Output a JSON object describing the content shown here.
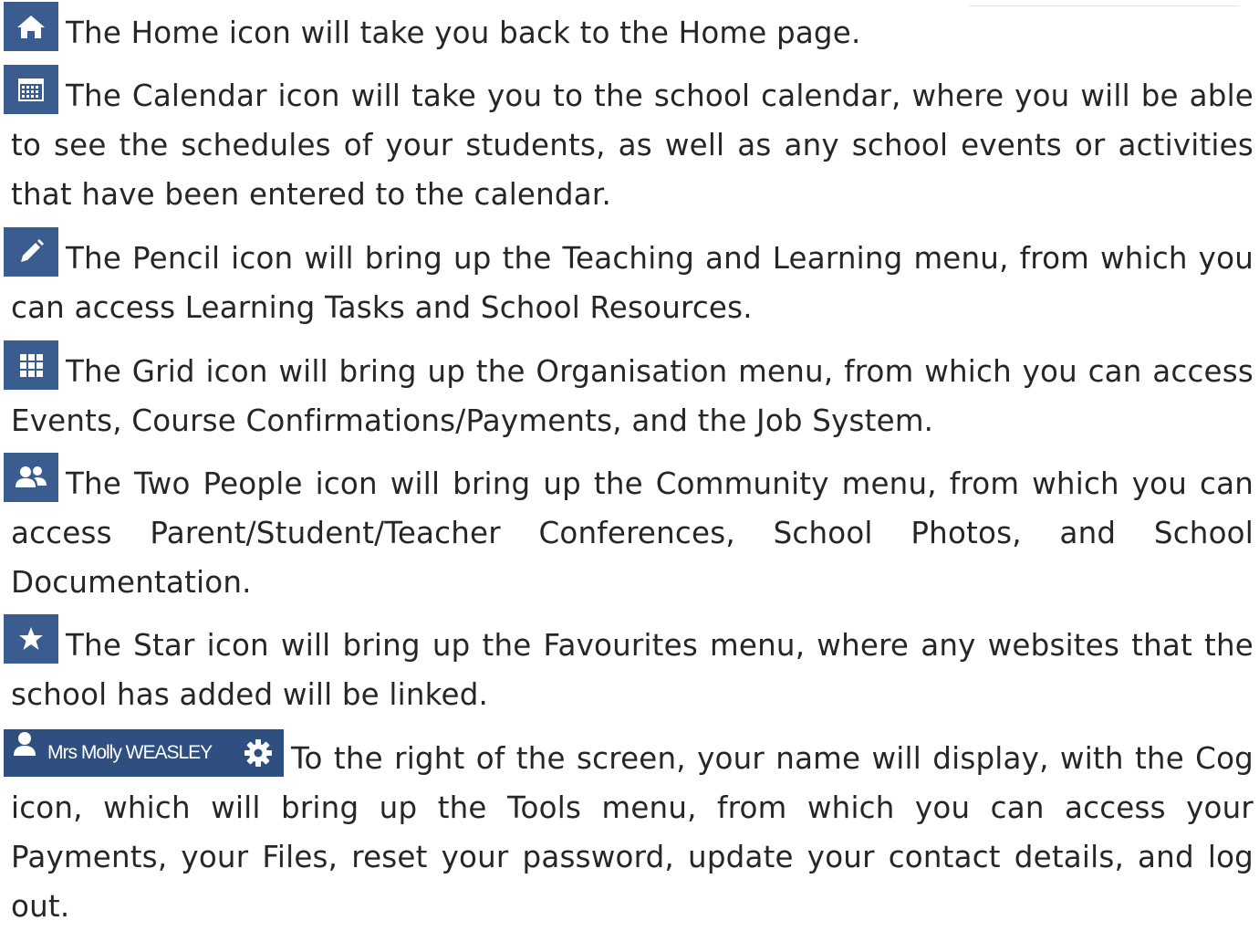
{
  "items": [
    {
      "icon": "home-icon",
      "text": "The Home icon will take you back to the Home page."
    },
    {
      "icon": "calendar-icon",
      "text": "The Calendar icon will take you to the school calendar, where you will be able to see the schedules of your students, as well as any school events or activities that have been entered to the calendar."
    },
    {
      "icon": "pencil-icon",
      "text": "The Pencil icon will bring up the Teaching and Learning menu, from which you can access Learning Tasks and School Resources."
    },
    {
      "icon": "grid-icon",
      "text": "The Grid icon will bring up the Organisation menu, from which you can access Events, Course Confirmations/Payments, and the Job System."
    },
    {
      "icon": "two-people-icon",
      "text": "The Two People icon will bring up the Community menu, from which you can access Parent/Student/Teacher Conferences, School Photos, and School Documentation."
    },
    {
      "icon": "star-icon",
      "text": "The Star icon will bring up the Favourites menu, where any websites that the school has added will be linked."
    },
    {
      "icon": "cog-icon",
      "text": "To the right of the screen, your name will display, with the Cog icon, which will bring up the Tools menu, from which you can access your Payments, your Files, reset your password, update your contact details, and log out."
    }
  ],
  "user_badge": {
    "name": "Mrs Molly WEASLEY"
  },
  "colors": {
    "icon_bg": "#3b5c8e",
    "badge_bg": "#2f4f80",
    "text": "#262626"
  }
}
